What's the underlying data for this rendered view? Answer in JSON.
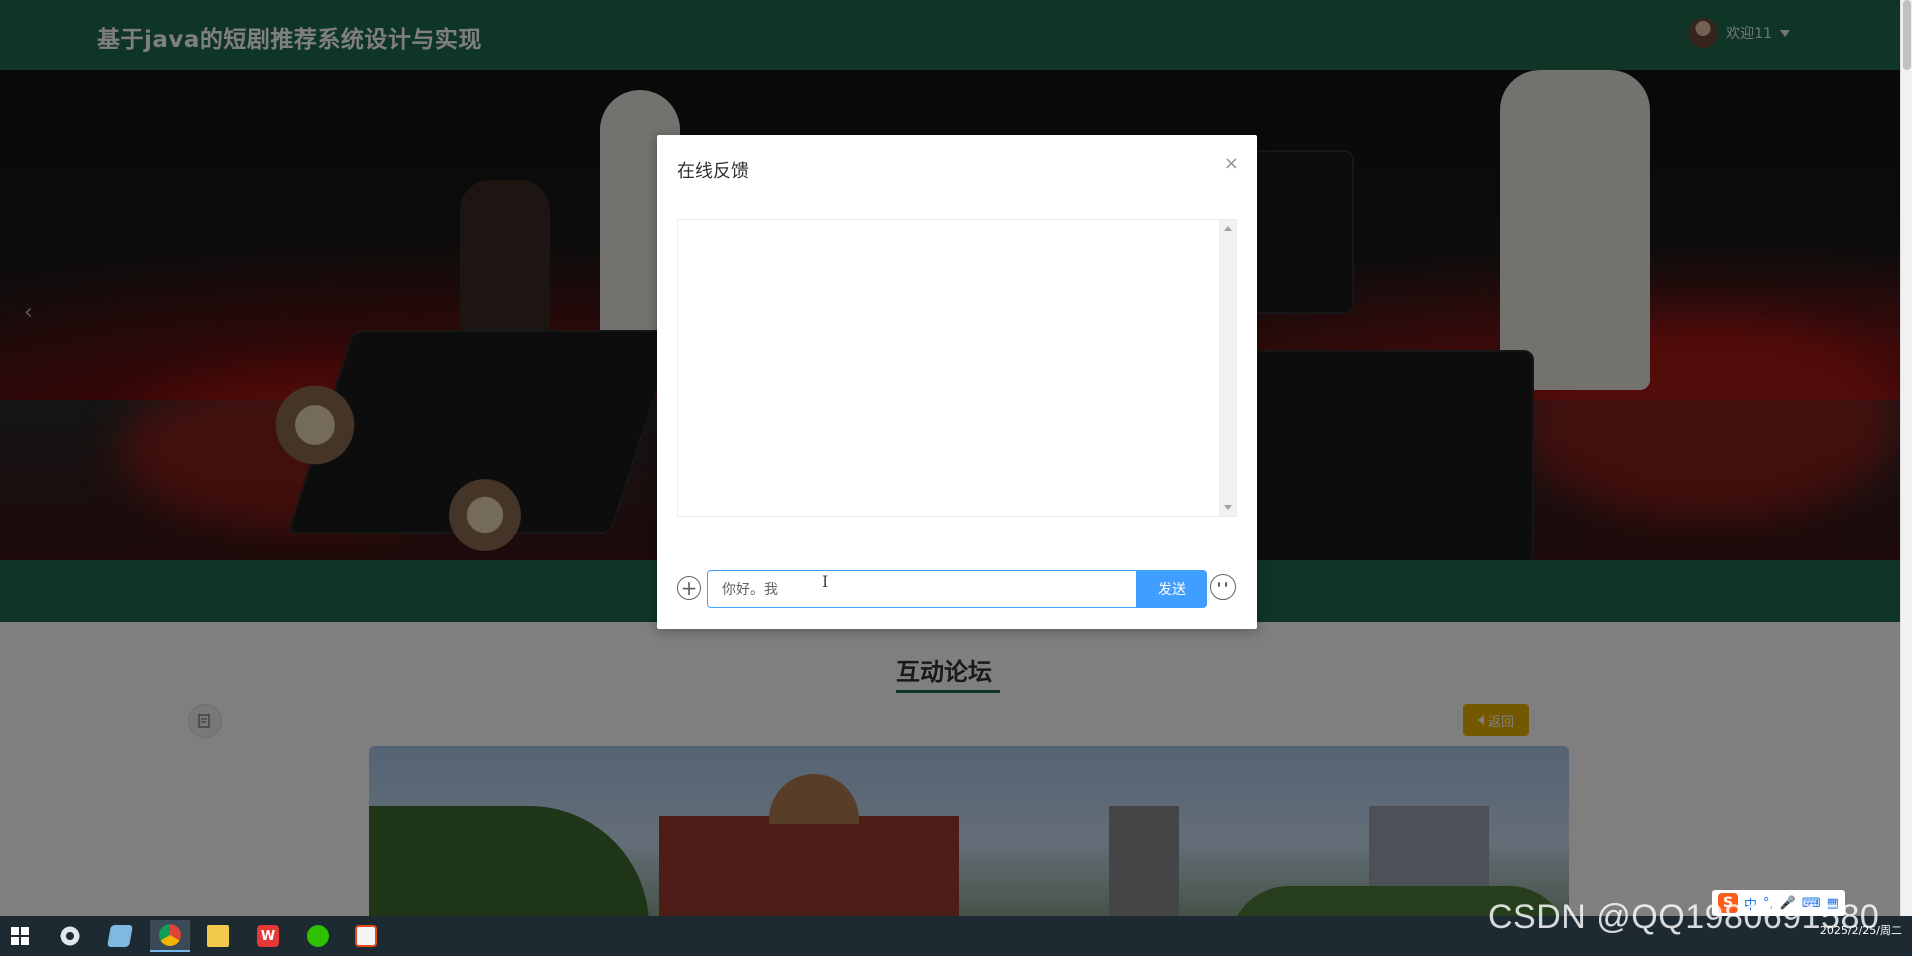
{
  "header": {
    "site_title": "基于java的短剧推荐系统设计与实现",
    "welcome_text": "欢迎11"
  },
  "banner": {
    "prev_arrow": "‹"
  },
  "forum": {
    "section_title": "互动论坛",
    "back_label": "返回"
  },
  "dialog": {
    "title": "在线反馈",
    "close_glyph": "×",
    "input_value": "你好。我",
    "send_label": "发送",
    "plus_glyph": "+"
  },
  "taskbar": {
    "apps": [
      "start",
      "settings",
      "notepad",
      "chrome",
      "file-explorer",
      "wps",
      "wechat",
      "presentation"
    ],
    "active": "chrome"
  },
  "tray": {
    "ime_label": "中",
    "ime_logo": "S",
    "date": "2025/2/25/周二"
  },
  "watermark": "CSDN @QQ1980691580",
  "colors": {
    "header_green": "#1f6b4e",
    "send_blue": "#409eff",
    "back_yellow": "#e6b100"
  }
}
